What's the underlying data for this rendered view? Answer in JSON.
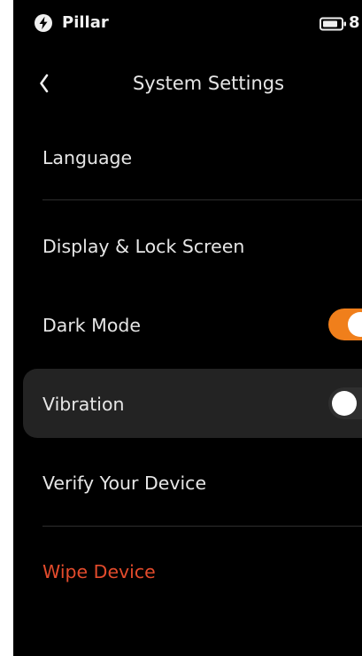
{
  "status_bar": {
    "app_name": "Pillar",
    "app_icon": "lightning-bolt-icon",
    "battery_icon": "battery-icon",
    "battery_text": "8"
  },
  "header": {
    "back_icon": "chevron-left-icon",
    "title": "System Settings"
  },
  "settings": {
    "language": {
      "label": "Language"
    },
    "display": {
      "label": "Display & Lock Screen"
    },
    "dark_mode": {
      "label": "Dark Mode",
      "enabled": true
    },
    "vibration": {
      "label": "Vibration",
      "enabled": false
    },
    "verify": {
      "label": "Verify Your Device"
    },
    "wipe": {
      "label": "Wipe Device"
    }
  },
  "colors": {
    "background": "#000000",
    "accent": "#f07f1b",
    "danger": "#e34b2c",
    "highlight_row": "#232323"
  }
}
